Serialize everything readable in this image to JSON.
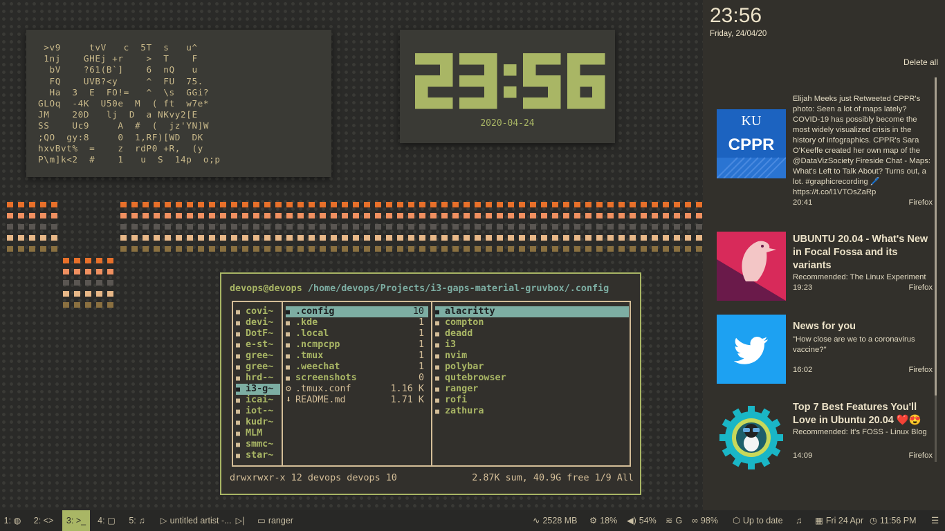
{
  "matrix": {
    "lines": [
      " >v9     tvV   c  5T  s   u^",
      " 1nj    GHEj +r    >  T    F",
      "  bV    ?61(B`]    6  nQ   u",
      "  FQ    UVB?<y     ^  FU  75.",
      "  Ha  3  E  FO!=   ^  \\s  GGi?",
      "GLOq  -4K  U50e  M  ( ft  w7e*",
      "JM    20D   lj  D  a NKvy2[E",
      "SS    Uc9     A  #  (  jz'YN]W",
      ";QO  gy:8     0  1,RF)[WD  DK",
      "hxvBvt%  =    z  rdP0 +R,  (y",
      "P\\m]k<2  #    1   u  S  14p  o;p"
    ]
  },
  "clock_widget": {
    "time": "23:56",
    "date": "2020-04-24"
  },
  "ranger": {
    "user": "devops@devops",
    "path": "/home/devops/Projects/i3-gaps-material-gruvbox/.config",
    "parent": [
      {
        "name": "covi~"
      },
      {
        "name": "devi~"
      },
      {
        "name": "DotF~"
      },
      {
        "name": "e-st~"
      },
      {
        "name": "gree~"
      },
      {
        "name": "gree~"
      },
      {
        "name": "hrd-~"
      },
      {
        "name": "i3-g~",
        "selected": true
      },
      {
        "name": "icai~"
      },
      {
        "name": "iot-~"
      },
      {
        "name": "kudr~"
      },
      {
        "name": "MLM"
      },
      {
        "name": "smmc~"
      },
      {
        "name": "star~"
      }
    ],
    "current": [
      {
        "icon": "folder",
        "name": ".config",
        "size": "10",
        "selected": true
      },
      {
        "icon": "folder",
        "name": ".kde",
        "size": "1"
      },
      {
        "icon": "folder",
        "name": ".local",
        "size": "1"
      },
      {
        "icon": "folder",
        "name": ".ncmpcpp",
        "size": "1"
      },
      {
        "icon": "folder",
        "name": ".tmux",
        "size": "1"
      },
      {
        "icon": "folder",
        "name": ".weechat",
        "size": "1"
      },
      {
        "icon": "folder",
        "name": "screenshots",
        "size": "0"
      },
      {
        "icon": "gear",
        "name": ".tmux.conf",
        "size": "1.16 K"
      },
      {
        "icon": "down-arrow",
        "name": "README.md",
        "size": "1.71 K"
      }
    ],
    "preview": [
      {
        "name": "alacritty",
        "selected": true
      },
      {
        "name": "compton"
      },
      {
        "name": "deadd"
      },
      {
        "name": "i3"
      },
      {
        "name": "nvim"
      },
      {
        "name": "polybar"
      },
      {
        "name": "qutebrowser"
      },
      {
        "name": "ranger"
      },
      {
        "name": "rofi"
      },
      {
        "name": "zathura"
      }
    ],
    "status_left": "drwxrwxr-x 12 devops devops 10",
    "status_right": "2.87K sum, 40.9G free  1/9  All"
  },
  "panel": {
    "time": "23:56",
    "date": "Friday, 24/04/20",
    "delete_all": "Delete all",
    "notifications": [
      {
        "thumb": "cppr",
        "thumb_text": [
          "KU",
          "CPPR"
        ],
        "title": "",
        "body": "Elijah Meeks just Retweeted CPPR's photo: Seen a lot of maps lately? COVID-19 has possibly become the most widely visualized crisis in the history of infographics. CPPR's Sara O'Keeffe created her own map of the @DataVizSociety Fireside Chat - Maps: What's Left to Talk About? Turns out, a lot. #graphicrecording 🖊️ https://t.co/l1VTOsZaRp",
        "time": "20:41",
        "source": "Firefox"
      },
      {
        "thumb": "ubuntu",
        "title": "UBUNTU 20.04 - What's New in Focal Fossa and its variants",
        "body": "Recommended: The Linux Experiment",
        "time": "19:23",
        "source": "Firefox"
      },
      {
        "thumb": "twitter",
        "title": "News for you",
        "body": "\"How close are we to a coronavirus vaccine?\"",
        "time": "16:02",
        "source": "Firefox"
      },
      {
        "thumb": "foss",
        "title": "Top 7 Best Features You'll Love in Ubuntu 20.04 ❤️😍",
        "body": "Recommended: It's FOSS - Linux Blog",
        "time": "14:09",
        "source": "Firefox"
      }
    ]
  },
  "bar": {
    "workspaces": [
      {
        "id": "1",
        "glyph": "◍"
      },
      {
        "id": "2",
        "glyph": "<>"
      },
      {
        "id": "3",
        "glyph": ">_",
        "active": true
      },
      {
        "id": "4",
        "glyph": "▢"
      },
      {
        "id": "5",
        "glyph": "♫"
      }
    ],
    "media": "untitled artist -...",
    "window": "ranger",
    "memory": "2528 MB",
    "cpu": "18%",
    "volume": "54%",
    "wifi": "G",
    "battery": "98%",
    "updates": "Up to date",
    "date": "Fri 24 Apr",
    "clock": "11:56 PM"
  },
  "colors": {
    "orange": "#e8702a",
    "orange_light": "#f09060",
    "grey": "#5a5652",
    "peach": "#e8b888",
    "brown": "#8a7040",
    "green": "#a9b665",
    "aqua": "#7daea3"
  }
}
